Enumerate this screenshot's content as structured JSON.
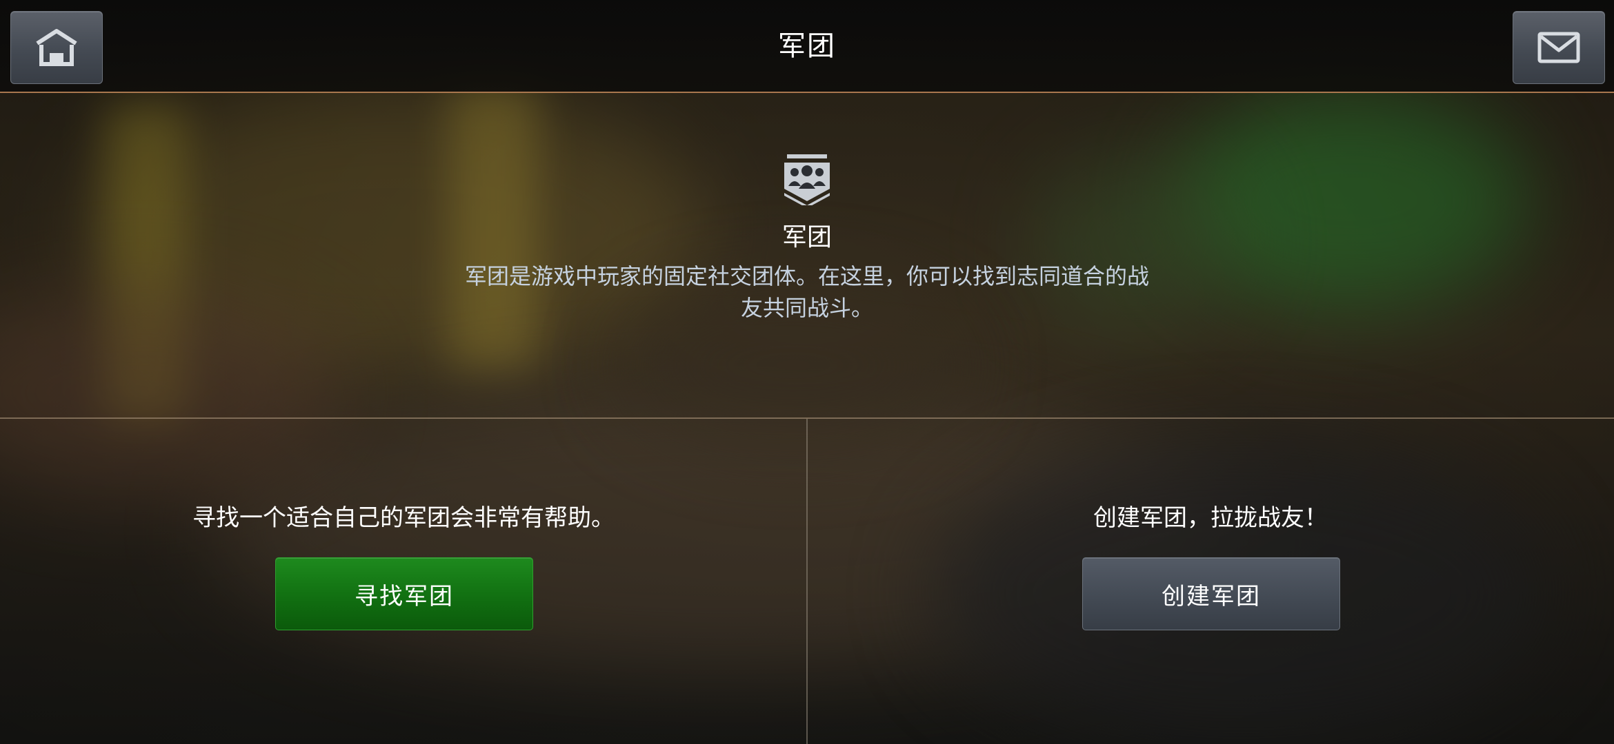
{
  "header": {
    "title": "军团",
    "home_icon": "home-icon",
    "mail_icon": "mail-icon"
  },
  "info": {
    "icon": "legion-group-icon",
    "title": "军团",
    "description": "军团是游戏中玩家的固定社交团体。在这里，你可以找到志同道合的战友共同战斗。"
  },
  "find_panel": {
    "text": "寻找一个适合自己的军团会非常有帮助。",
    "button_label": "寻找军团",
    "button_color": "#127212"
  },
  "create_panel": {
    "text": "创建军团，拉拢战友！",
    "button_label": "创建军团",
    "button_color": "#434a54"
  },
  "colors": {
    "divider_accent": "#a9774e",
    "description_text": "#c6d2e0"
  }
}
